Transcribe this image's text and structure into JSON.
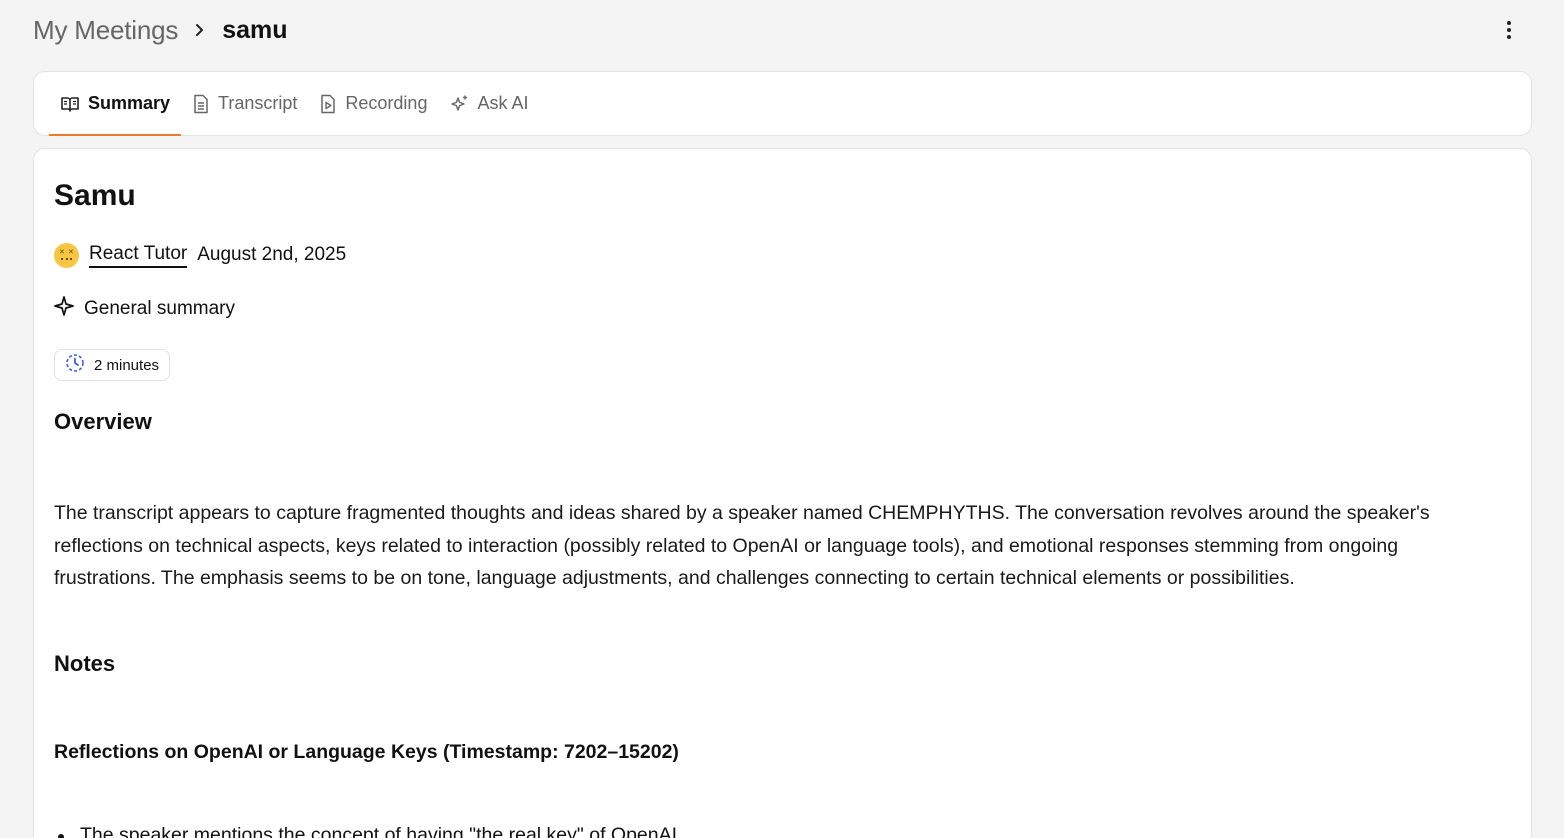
{
  "breadcrumb": {
    "root": "My Meetings",
    "current": "samu"
  },
  "tabs": [
    {
      "label": "Summary",
      "icon": "book-open-icon",
      "active": true
    },
    {
      "label": "Transcript",
      "icon": "document-icon",
      "active": false
    },
    {
      "label": "Recording",
      "icon": "file-play-icon",
      "active": false
    },
    {
      "label": "Ask AI",
      "icon": "sparkles-icon",
      "active": false
    }
  ],
  "meeting": {
    "title": "Samu",
    "organizer": "React Tutor",
    "date": "August 2nd, 2025",
    "template": "General summary",
    "duration": "2 minutes"
  },
  "sections": {
    "overview_heading": "Overview",
    "overview_text": "The transcript appears to capture fragmented thoughts and ideas shared by a speaker named CHEMPHYTHS. The conversation revolves around the speaker's reflections on technical aspects, keys related to interaction (possibly related to OpenAI or language tools), and emotional responses stemming from ongoing frustrations. The emphasis seems to be on tone, language adjustments, and challenges connecting to certain technical elements or possibilities.",
    "notes_heading": "Notes",
    "notes_subheading": "Reflections on OpenAI or Language Keys (Timestamp: 7202–15202)",
    "notes_bullet": "The speaker mentions the concept of having \"the real key\" of OpenAI."
  },
  "colors": {
    "accent": "#ea7a2f",
    "clock": "#3b5bdb",
    "avatar": "#f7c744"
  }
}
